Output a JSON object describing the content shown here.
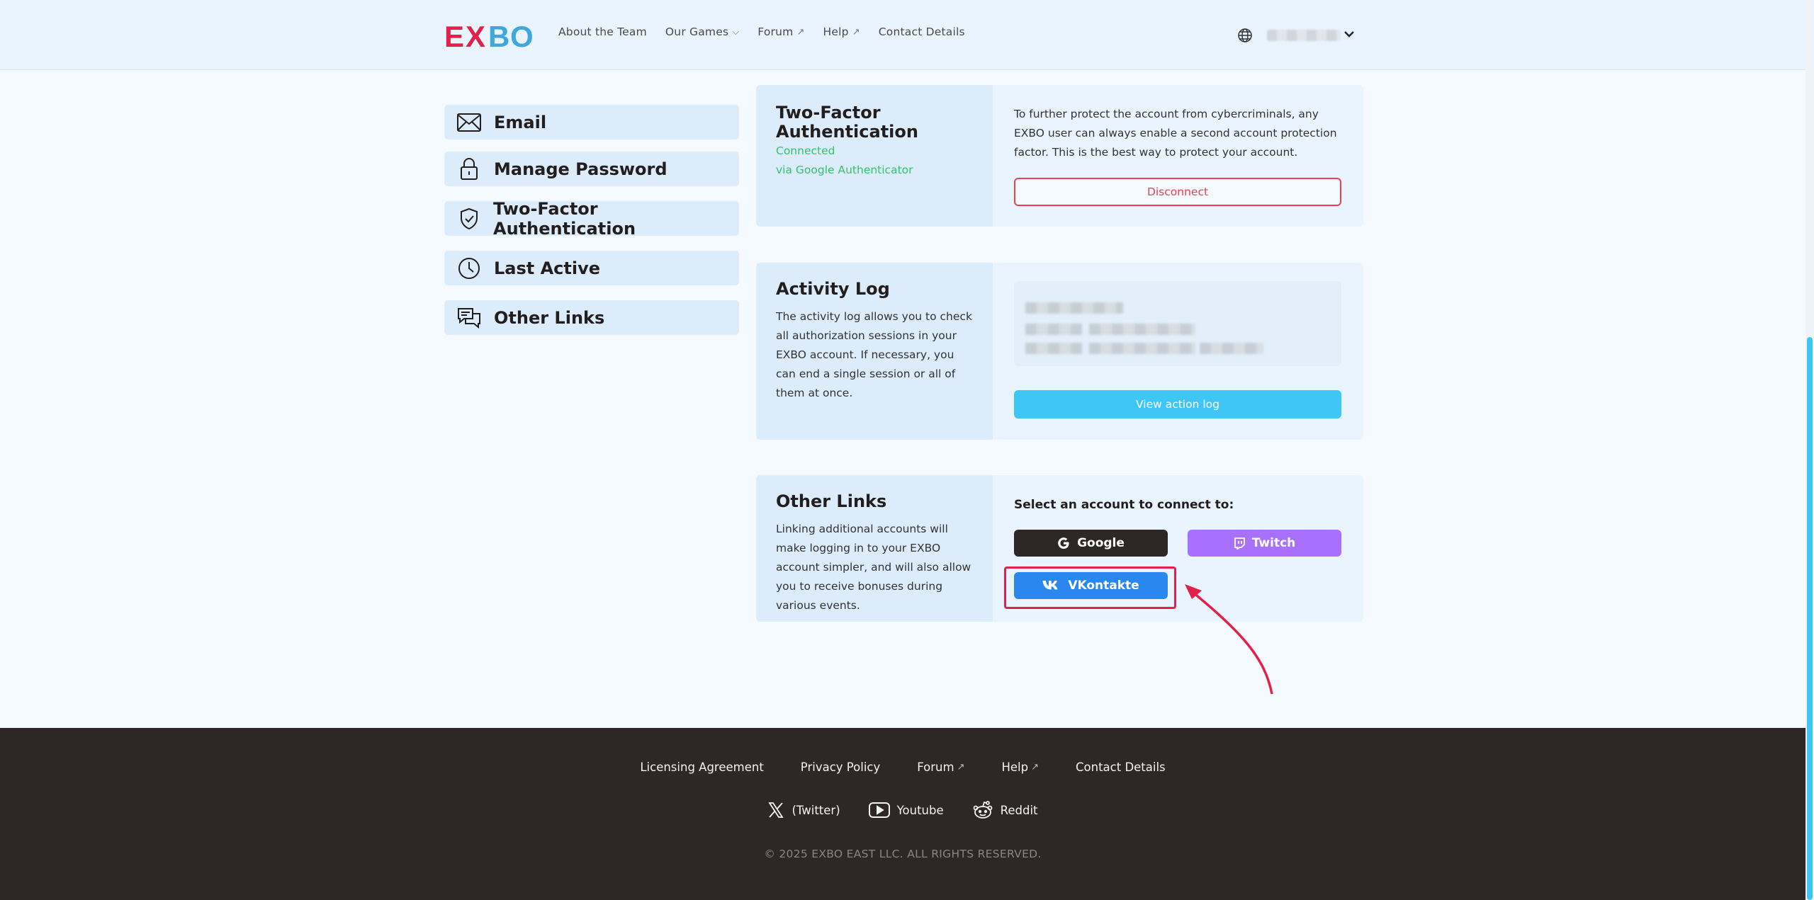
{
  "header": {
    "nav": [
      {
        "label": "About the Team",
        "suffix": ""
      },
      {
        "label": "Our Games",
        "suffix": "⌵"
      },
      {
        "label": "Forum",
        "suffix": "↗"
      },
      {
        "label": "Help",
        "suffix": "↗"
      },
      {
        "label": "Contact Details",
        "suffix": ""
      }
    ]
  },
  "sidebar": {
    "items": [
      {
        "label": "Email",
        "icon": "envelope-icon"
      },
      {
        "label": "Manage Password",
        "icon": "lock-icon"
      },
      {
        "label": "Two-Factor Authentication",
        "icon": "shield-check-icon"
      },
      {
        "label": "Last Active",
        "icon": "clock-icon"
      },
      {
        "label": "Other Links",
        "icon": "chat-icon"
      }
    ]
  },
  "twofa": {
    "title": "Two-Factor Authentication",
    "status": "Connected",
    "method": "via Google Authenticator",
    "description": "To further protect the account from cybercriminals, any EXBO user can always enable a second account protection factor. This is the best way to protect your account.",
    "button": "Disconnect"
  },
  "activity": {
    "title": "Activity Log",
    "description": "The activity log allows you to check all authorization sessions in your EXBO account. If necessary, you can end a single session or all of them at once.",
    "button": "View action log"
  },
  "other_links": {
    "title": "Other Links",
    "description": "Linking additional accounts will make logging in to your EXBO account simpler, and will also allow you to receive bonuses during various events.",
    "prompt": "Select an account to connect to:",
    "google": "Google",
    "twitch": "Twitch",
    "vk": "VKontakte"
  },
  "footer": {
    "links": [
      {
        "label": "Licensing Agreement",
        "suffix": ""
      },
      {
        "label": "Privacy Policy",
        "suffix": ""
      },
      {
        "label": "Forum",
        "suffix": "↗"
      },
      {
        "label": "Help",
        "suffix": "↗"
      },
      {
        "label": "Contact Details",
        "suffix": ""
      }
    ],
    "social": {
      "twitter": "(Twitter)",
      "youtube": "Youtube",
      "reddit": "Reddit"
    },
    "copyright": "© 2025 EXBO EAST LLC. ALL RIGHTS RESERVED."
  },
  "colors": {
    "brand_red": "#e2214b",
    "brand_blue": "#3ec6f6",
    "google_btn": "#2e2727",
    "twitch_btn": "#a970ff",
    "vk_btn": "#2b87f0",
    "success": "#33c36b"
  }
}
